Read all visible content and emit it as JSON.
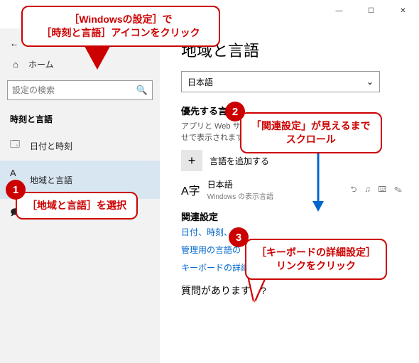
{
  "titlebar": {
    "min": "—",
    "max": "☐",
    "close": "✕"
  },
  "sidebar": {
    "back_icon": "←",
    "home_icon": "⌂",
    "home_label": "ホーム",
    "search_placeholder": "設定の検索",
    "search_icon": "🔍",
    "category": "時刻と言語",
    "items": [
      {
        "icon": "🗔",
        "label": "日付と時刻"
      },
      {
        "icon": "A字",
        "label": "地域と言語"
      },
      {
        "icon": "🗩",
        "label": ""
      }
    ]
  },
  "main": {
    "title": "地域と言語",
    "dropdown_value": "日本語",
    "dropdown_chevron": "⌄",
    "preferred_heading": "優先する言語",
    "preferred_desc": "アプリと Web サイ\nせで表示されます",
    "add_lang_label": "言語を追加する",
    "add_lang_plus": "+",
    "lang_icon": "A字",
    "lang_name": "日本語",
    "lang_sub": "Windows の表示言語",
    "lang_right_icons": "⮌ ♫ ⌨ ✎",
    "related_heading": "関連設定",
    "link_date": "日付、時刻、地",
    "link_admin": "管理用の言語の",
    "link_keyboard": "キーボードの詳細設定",
    "question": "質問がありますか?"
  },
  "annotations": {
    "top": "［Windowsの設定］で\n［時刻と言語］アイコンをクリック",
    "c1": "［地域と言語］を選択",
    "c2": "「関連設定」が見えるまで\nスクロール",
    "c3": "［キーボードの詳細設定］\nリンクをクリック",
    "n1": "1",
    "n2": "2",
    "n3": "3"
  }
}
